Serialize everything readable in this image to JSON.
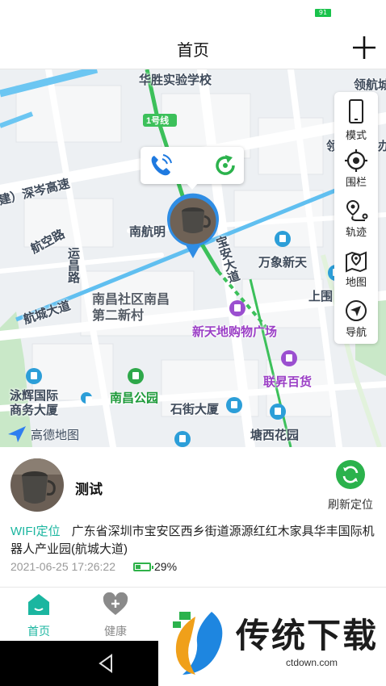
{
  "status_bar": {
    "battery": "91"
  },
  "header": {
    "title": "首页"
  },
  "map": {
    "labels": {
      "school": "华胜实验学校",
      "line1": "1号线",
      "linghang": "领航城",
      "expressway": "建）深岑高速",
      "hangkong_rd": "航空路",
      "yunchang_rd": "运昌路",
      "nanhang": "南航明",
      "baoan": "宝安大道",
      "wanxiang": "万象新天",
      "shangwei": "上围",
      "hangcheng": "航城大道",
      "community": "南昌社区南昌第二新村",
      "xintiandi": "新天地购物广场",
      "lianxing": "联昇百货",
      "yonghui": "泳辉国际商务大厦",
      "nanchang_park": "南昌公园",
      "shijie": "石街大厦",
      "tangxi": "塘西花园",
      "ling_partial": "领",
      "ban_partial": "办"
    },
    "logo": "高德地图",
    "colors": {
      "accent": "#1bb6a0",
      "road_blue": "#60bff0",
      "metro_green": "#3cc05a"
    }
  },
  "toolbar": {
    "items": [
      {
        "label": "模式",
        "icon": "phone-mode-icon"
      },
      {
        "label": "围栏",
        "icon": "fence-target-icon"
      },
      {
        "label": "轨迹",
        "icon": "track-icon"
      },
      {
        "label": "地图",
        "icon": "map-icon"
      },
      {
        "label": "导航",
        "icon": "navigation-icon"
      }
    ]
  },
  "device": {
    "name": "测试",
    "refresh_label": "刷新定位",
    "location_type": "WIFI定位",
    "address": "广东省深圳市宝安区西乡街道源源红红木家具华丰国际机器人产业园(航城大道)",
    "timestamp": "2021-06-25 17:26:22",
    "battery": "29%"
  },
  "tabs": [
    {
      "label": "首页",
      "icon": "home-icon",
      "active": true
    },
    {
      "label": "健康",
      "icon": "health-heart-icon",
      "active": false
    }
  ],
  "watermark": {
    "text": "传统下载",
    "url": "ctdown.com"
  }
}
